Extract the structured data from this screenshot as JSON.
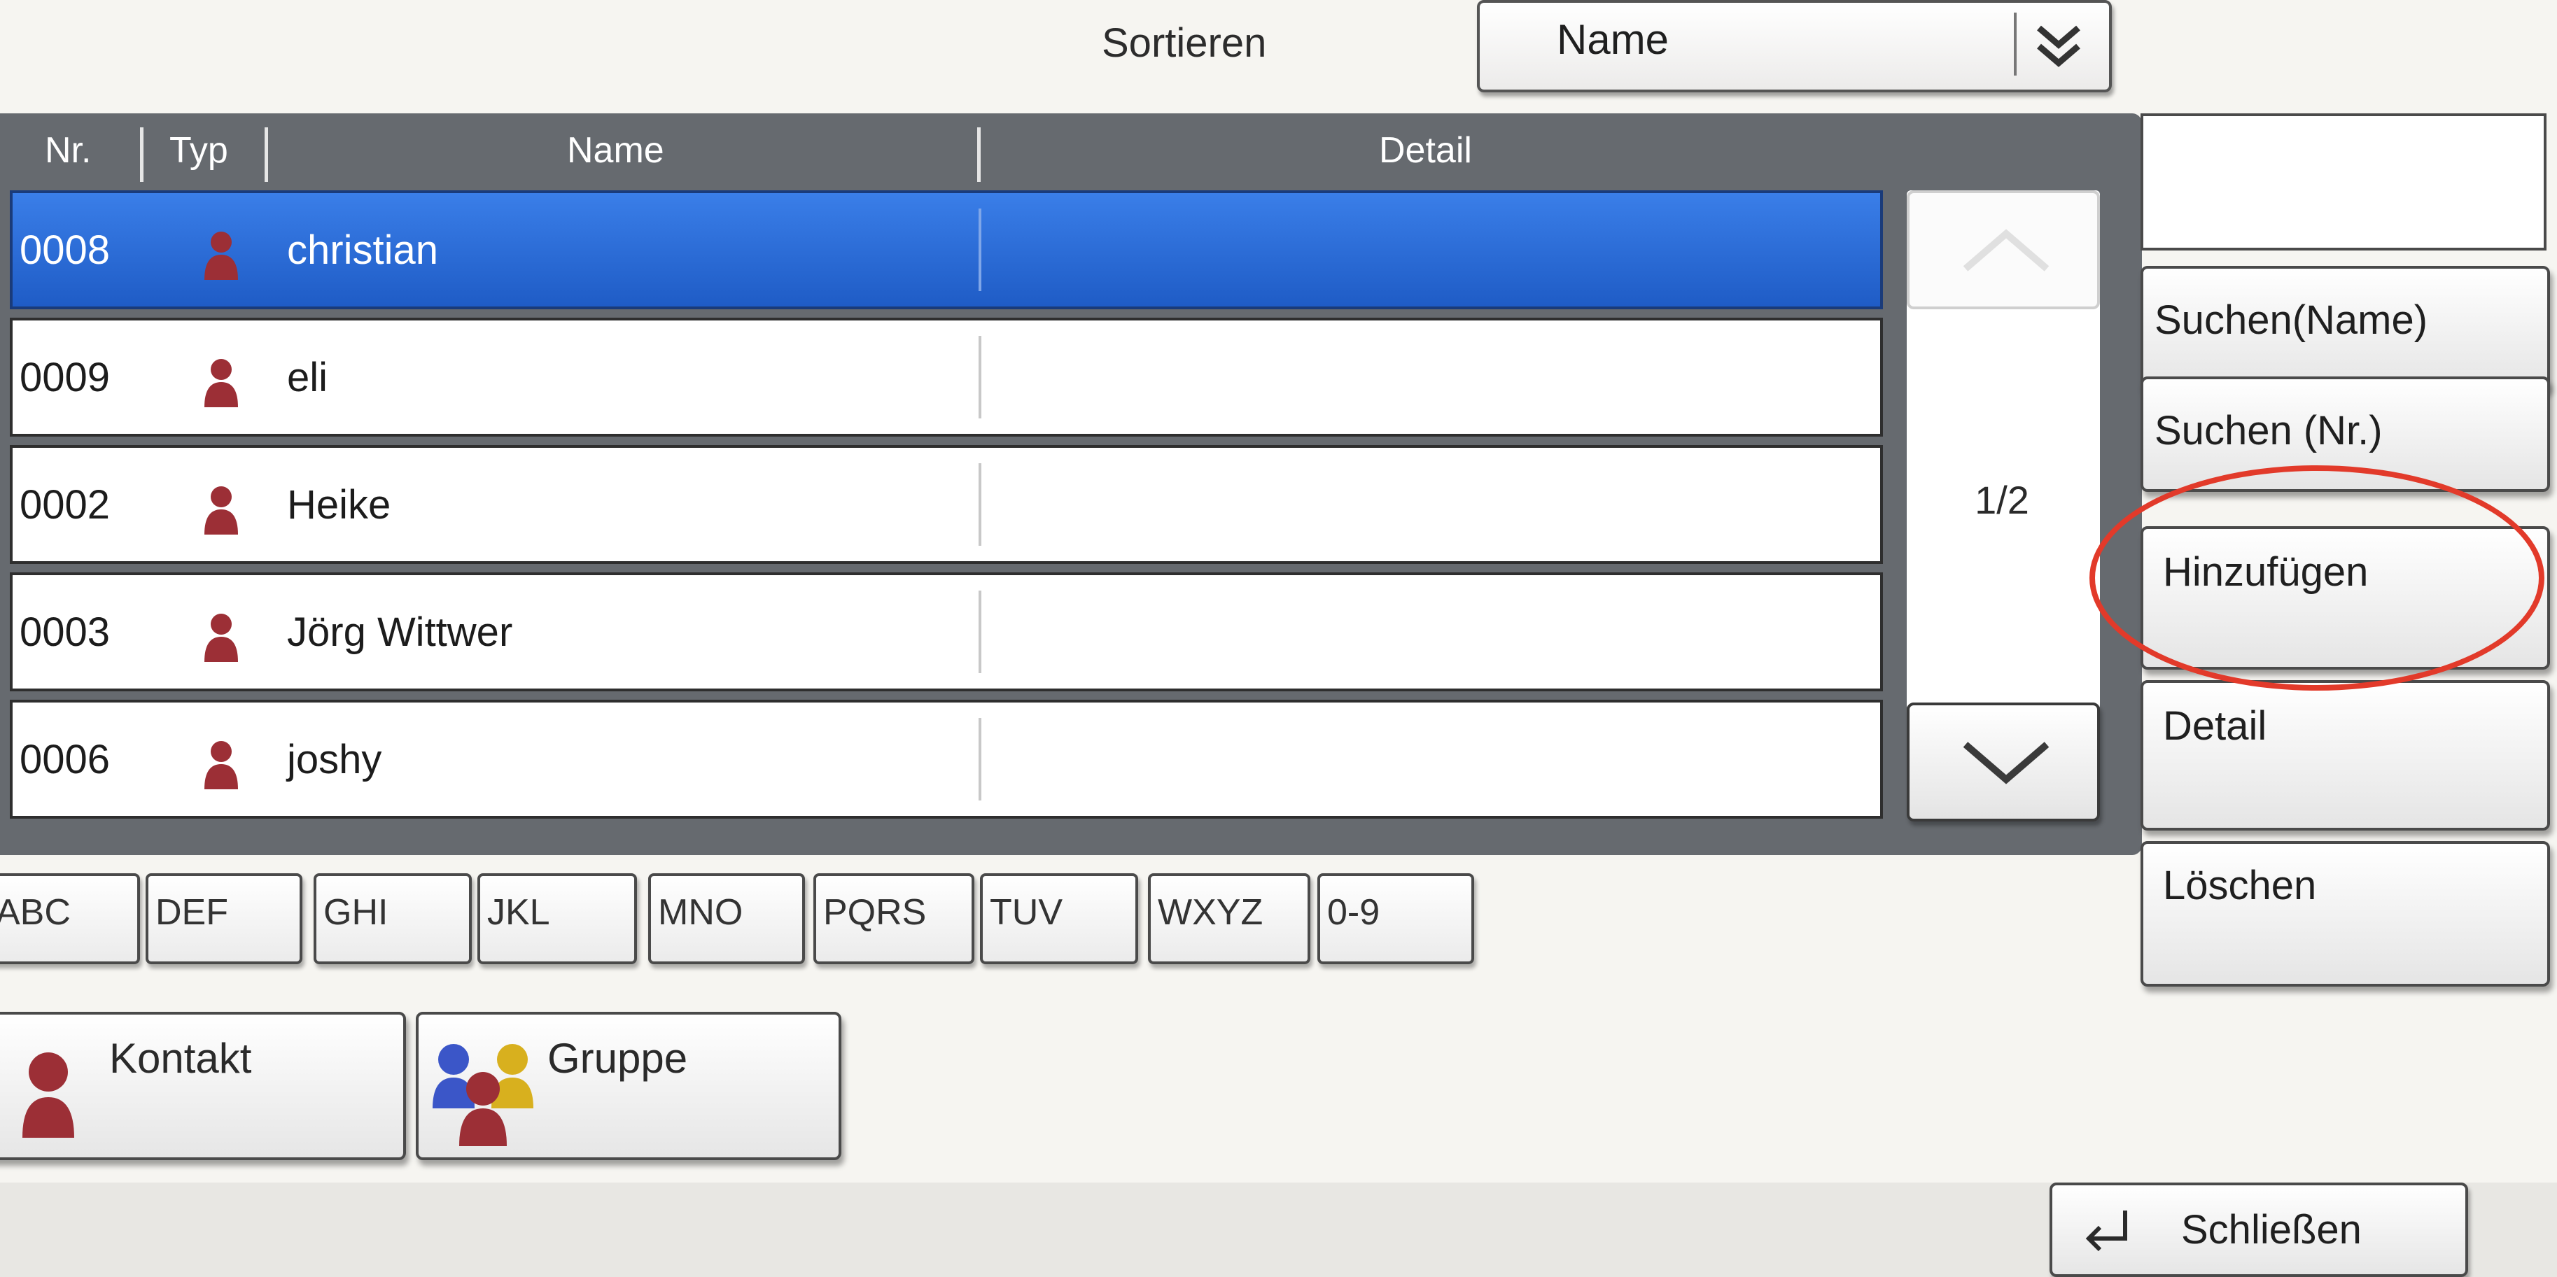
{
  "sort": {
    "label": "Sortieren",
    "value": "Name"
  },
  "columns": {
    "nr": "Nr.",
    "typ": "Typ",
    "name": "Name",
    "detail": "Detail"
  },
  "rows": [
    {
      "nr": "0008",
      "name": "christian",
      "type": "person-icon",
      "selected": true
    },
    {
      "nr": "0009",
      "name": "eli",
      "type": "person-icon",
      "selected": false
    },
    {
      "nr": "0002",
      "name": "Heike",
      "type": "person-icon",
      "selected": false
    },
    {
      "nr": "0003",
      "name": "Jörg Wittwer",
      "type": "person-icon",
      "selected": false
    },
    {
      "nr": "0006",
      "name": "joshy",
      "type": "person-icon",
      "selected": false
    }
  ],
  "pager": {
    "indicator": "1/2"
  },
  "letters": [
    "ABC",
    "DEF",
    "GHI",
    "JKL",
    "MNO",
    "PQRS",
    "TUV",
    "WXYZ",
    "0-9"
  ],
  "type_buttons": {
    "contact": "Kontakt",
    "group": "Gruppe"
  },
  "side": {
    "search_name": "Suchen(Name)",
    "search_nr": "Suchen (Nr.)",
    "add": "Hinzufügen",
    "detail": "Detail",
    "delete": "Löschen"
  },
  "close": "Schließen",
  "colors": {
    "selected_row": "#2b6fdc",
    "panel": "#666a6f",
    "highlight_ring": "#e23a2a"
  }
}
